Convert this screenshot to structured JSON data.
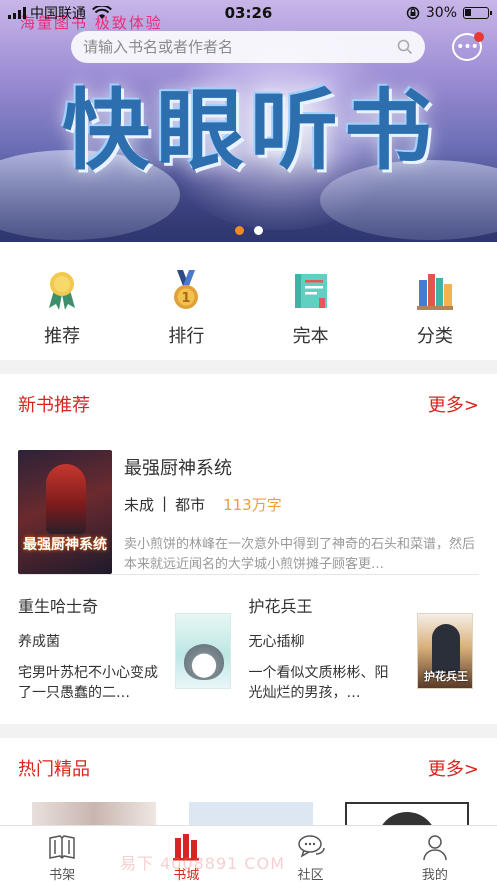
{
  "status": {
    "carrier": "中国联通",
    "time": "03:26",
    "battery": "30%"
  },
  "banner": {
    "slogan": "海量图书 极致体验",
    "title": "快眼听书",
    "dot_count": 2,
    "active_dot": 0
  },
  "search": {
    "placeholder": "请输入书名或者作者名"
  },
  "categories": [
    {
      "label": "推荐",
      "icon": "medal-ribbon-icon"
    },
    {
      "label": "排行",
      "icon": "gold-medal-icon"
    },
    {
      "label": "完本",
      "icon": "books-icon"
    },
    {
      "label": "分类",
      "icon": "bookshelf-icon"
    }
  ],
  "new_books": {
    "title": "新书推荐",
    "more": "更多>",
    "featured": {
      "cover_text": "最强厨神系统",
      "title": "最强厨神系统",
      "author": "未成",
      "genre": "都市",
      "separator": "|",
      "words": "113万字",
      "desc": "卖小煎饼的林峰在一次意外中得到了神奇的石头和菜谱，然后本来就远近闻名的大学城小煎饼摊子顾客更…"
    },
    "pair": [
      {
        "title": "重生哈士奇",
        "author": "养成菌",
        "desc": "宅男叶苏杞不小心变成了一只愚蠢的二…"
      },
      {
        "title": "护花兵王",
        "author": "无心插柳",
        "desc": "一个看似文质彬彬、阳光灿烂的男孩，…",
        "cover_text": "护花兵王"
      }
    ]
  },
  "hot": {
    "title": "热门精品",
    "more": "更多>"
  },
  "tabs": [
    {
      "label": "书架",
      "icon": "bookshelf-tab-icon"
    },
    {
      "label": "书城",
      "icon": "bookstore-tab-icon"
    },
    {
      "label": "社区",
      "icon": "chat-bubbles-icon"
    },
    {
      "label": "我的",
      "icon": "user-icon"
    }
  ],
  "active_tab": 1,
  "watermark": "易下    4008891   COM",
  "colors": {
    "accent": "#d7261f",
    "words": "#e9a23b",
    "dot_active": "#f08a24"
  }
}
